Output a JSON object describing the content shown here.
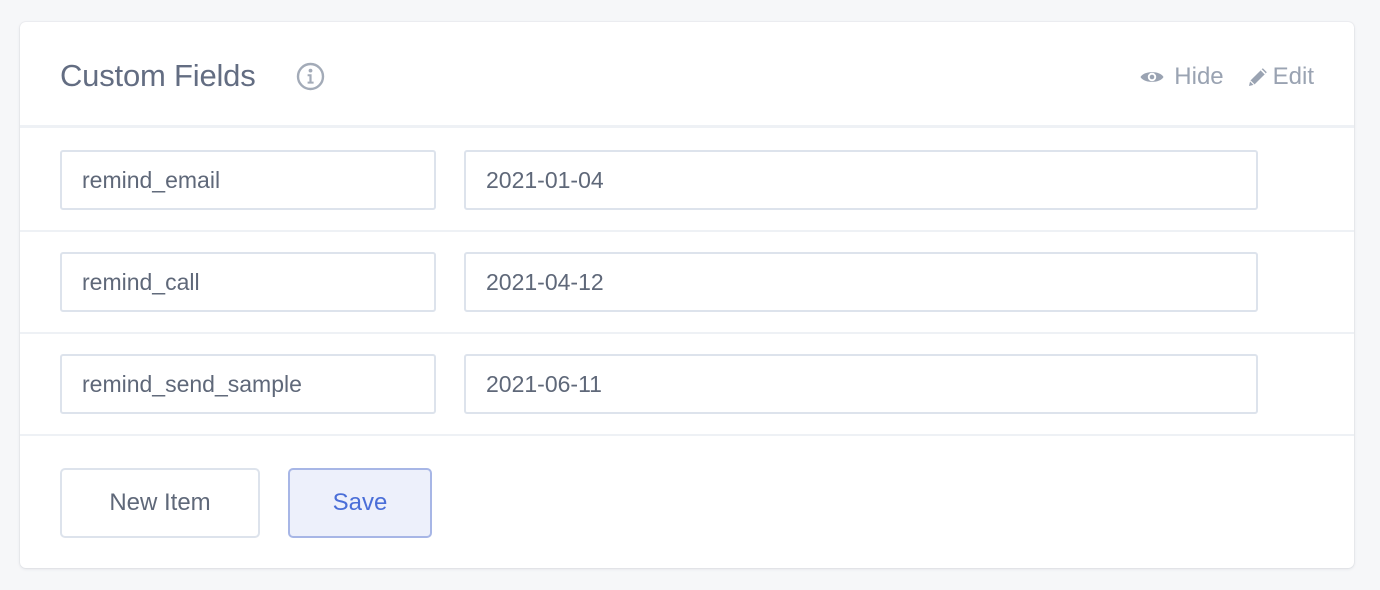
{
  "header": {
    "title": "Custom Fields",
    "info_icon": "info-circle-icon",
    "hide_label": "Hide",
    "hide_icon": "eye-icon",
    "edit_label": "Edit",
    "edit_icon": "pencil-icon"
  },
  "fields": [
    {
      "key": "remind_email",
      "value": "2021-01-04"
    },
    {
      "key": "remind_call",
      "value": "2021-04-12"
    },
    {
      "key": "remind_send_sample",
      "value": "2021-06-11"
    }
  ],
  "footer": {
    "new_item_label": "New Item",
    "save_label": "Save"
  },
  "colors": {
    "accent": "#4a6ed8",
    "text": "#5f6879",
    "muted": "#9aa3b2",
    "border": "#dde3ec"
  }
}
